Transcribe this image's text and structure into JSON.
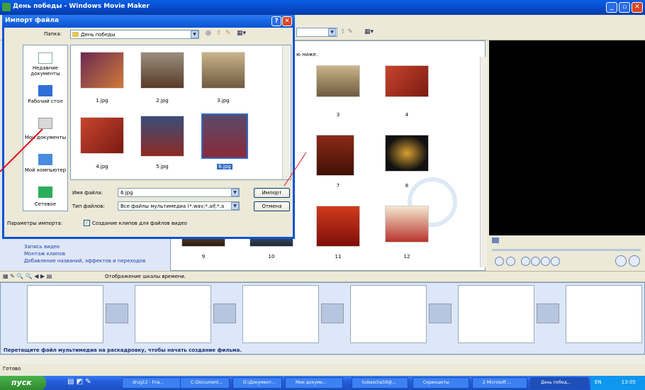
{
  "app": {
    "title": "День победы - Windows Movie Maker"
  },
  "collection": {
    "hint": "ю ниже.",
    "captions": [
      "3",
      "4",
      "7",
      "8",
      "9",
      "10",
      "11",
      "12"
    ]
  },
  "tasks": {
    "items": [
      "Запись видео",
      "Монтаж клипов",
      "Добавление названий, эффектов и переходов"
    ]
  },
  "storyboard": {
    "toolbar_label": "Отображение шкалы времени.",
    "hint": "Перетащите файл мультимедиа на раскадровку, чтобы начать создание фильма."
  },
  "status": {
    "text": "Готово"
  },
  "dialog": {
    "title": "Импорт файла",
    "folder_label": "Папка:",
    "folder_value": "День победы",
    "places": [
      {
        "label": "Недавние документы",
        "icon": "recent-docs-icon"
      },
      {
        "label": "Рабочий стол",
        "icon": "desktop-icon"
      },
      {
        "label": "Мои документы",
        "icon": "my-docs-icon"
      },
      {
        "label": "Мой компьютер",
        "icon": "my-computer-icon"
      },
      {
        "label": "Сетевое",
        "icon": "network-icon"
      }
    ],
    "files": [
      "1.jpg",
      "2.jpg",
      "3.jpg",
      "4.jpg",
      "5.jpg",
      "6.jpg"
    ],
    "filename_label": "Имя файла:",
    "filename_value": "6.jpg",
    "filetype_label": "Тип файлов:",
    "filetype_value": "Все файлы мультимедиа (*.wav;*.aif;*.a",
    "import_button": "Импорт",
    "cancel_button": "Отмена",
    "options_label": "Параметры импорта:",
    "options_checkbox": "Создание клипов для файлов видео"
  },
  "taskbar": {
    "start": "пуск",
    "items": [
      "drug12 - Fna...",
      "C:\\Document...",
      "D:\\Документ...",
      "Мои докуме...",
      "kubascha59@...",
      "Скриншоты",
      "2 Microsoft ...",
      "День побед..."
    ],
    "lang": "EN",
    "clock": "13:05"
  },
  "colors": {
    "accent": "#0a5fe4",
    "annotation": "#e0141a"
  }
}
